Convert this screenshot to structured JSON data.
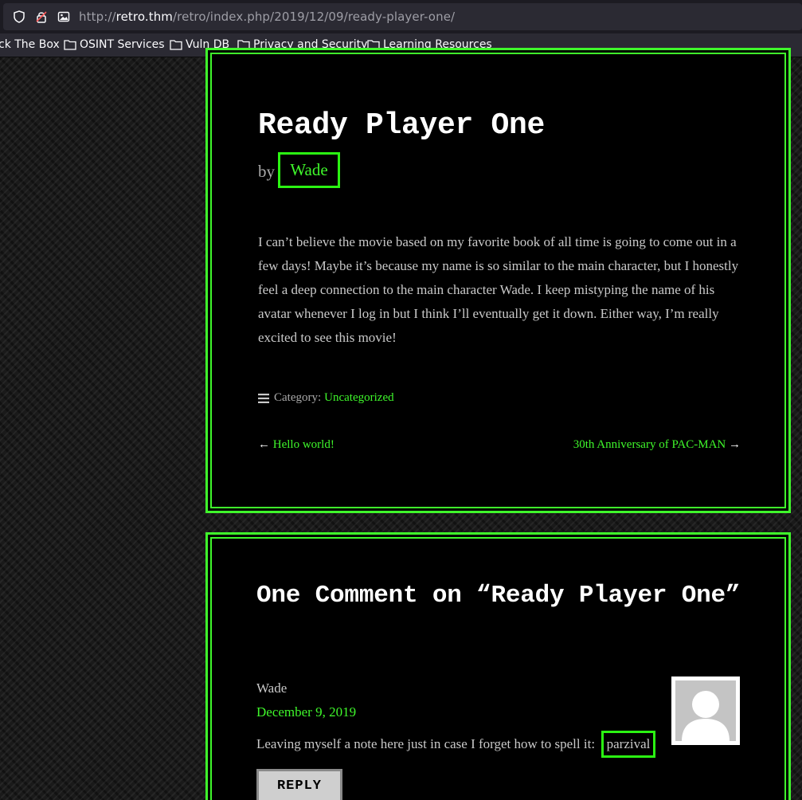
{
  "browser": {
    "url_prefix": "http://",
    "url_host": "retro.thm",
    "url_path": "/retro/index.php/2019/12/09/ready-player-one/",
    "icons": [
      "shield-icon",
      "lock-icon",
      "image-icon"
    ],
    "bookmarks": [
      {
        "label": "ck The Box",
        "icon": ""
      },
      {
        "label": "OSINT Services",
        "icon": "folder-icon"
      },
      {
        "label": "Vuln DB",
        "icon": "folder-icon"
      },
      {
        "label": "Privacy and Security",
        "icon": "folder-icon"
      },
      {
        "label": "Learning Resources",
        "icon": "folder-icon"
      }
    ]
  },
  "post": {
    "title": "Ready Player One",
    "by_prefix": "by",
    "author": "Wade",
    "body": "I can’t believe the movie based on my favorite book of all time is going to come out in a few days! Maybe it’s because my name is so similar to the main character, but I honestly feel a deep connection to the main character Wade. I keep mistyping the name of his avatar whenever I log in but I think I’ll eventually get it down. Either way, I’m really excited to see this movie!",
    "category_label": "Category:",
    "category": "Uncategorized",
    "prev_arrow": "←",
    "prev_link": "Hello world!",
    "next_link": "30th Anniversary of PAC-MAN",
    "next_arrow": "→"
  },
  "comments": {
    "title": "One Comment on “Ready Player One”",
    "items": [
      {
        "author": "Wade",
        "date": "December 9, 2019",
        "text_prefix": "Leaving myself a note here just in case I forget how to spell it:",
        "highlight": "parzival",
        "reply_label": "REPLY"
      }
    ]
  },
  "colors": {
    "accent_green": "#3ff72b",
    "highlight_box": "#2bf512",
    "background": "#000000",
    "text": "#c9c9c9"
  }
}
